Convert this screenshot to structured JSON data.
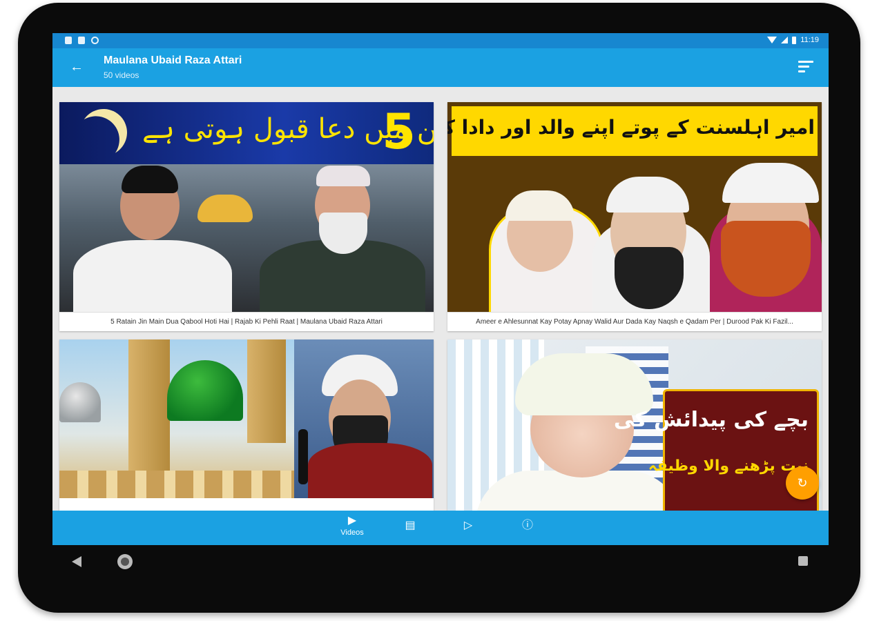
{
  "status_bar": {
    "time": "11:19"
  },
  "app_bar": {
    "title": "Maulana Ubaid Raza Attari",
    "subtitle": "50 videos"
  },
  "videos": [
    {
      "caption": "5 Ratain Jin Main Dua Qabool Hoti Hai | Rajab Ki Pehli Raat | Maulana Ubaid Raza Attari",
      "thumb_text": "راتیں جن میں دعا قبول ہوتی ہے",
      "thumb_number": "5"
    },
    {
      "caption": "Ameer e Ahlesunnat Kay Potay Apnay Walid Aur Dada Kay Naqsh e Qadam Per | Durood Pak Ki Fazil...",
      "thumb_text": "امیر اہلسنت کے پوتے اپنے والد اور دادا کے نقشِ قدم پر"
    },
    {
      "caption": "",
      "thumb_text": ""
    },
    {
      "caption": "",
      "thumb_text_line1": "بچے کی پیدائش کی",
      "thumb_text_line2": "نیت پڑھنے والا وظیفہ"
    }
  ],
  "bottom_nav": {
    "items": [
      {
        "label": "Videos",
        "icon": "video-library-icon",
        "active": true
      },
      {
        "label": "",
        "icon": "playlist-icon",
        "active": false
      },
      {
        "label": "",
        "icon": "play-box-icon",
        "active": false
      },
      {
        "label": "",
        "icon": "info-icon",
        "active": false
      }
    ]
  },
  "colors": {
    "primary": "#1ba1e2",
    "status_bar": "#1787d0",
    "fab": "#ff9f00"
  }
}
